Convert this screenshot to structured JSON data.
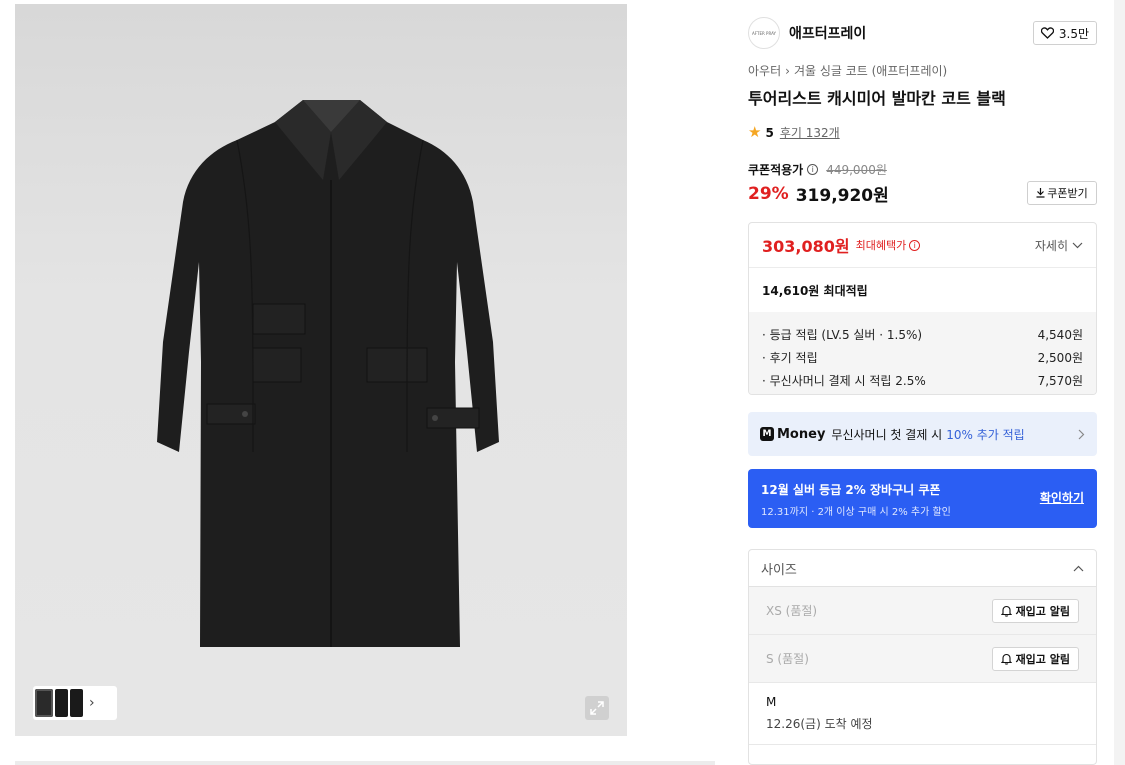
{
  "gallery": {
    "thumbnail_chevron": "›"
  },
  "brand": {
    "logo_text": "AFTER PRAY",
    "name": "애프터프레이",
    "like_count": "3.5만"
  },
  "breadcrumb": {
    "root": "아우터",
    "separator": "›",
    "category": "겨울 싱글 코트 (애프터프레이)"
  },
  "product": {
    "title": "투어리스트 캐시미어 발마칸 코트 블랙",
    "rating": "5",
    "review_label": "후기 132개"
  },
  "price": {
    "label": "쿠폰적용가",
    "original": "449,000원",
    "discount": "29%",
    "current": "319,920원",
    "coupon_button": "쿠폰받기"
  },
  "benefit": {
    "max_price": "303,080원",
    "max_label": "최대혜택가",
    "detail_button": "자세히",
    "points_total": "14,610원 최대적립",
    "points": [
      {
        "label": "· 등급 적립 (LV.5 실버 · 1.5%)",
        "value": "4,540원"
      },
      {
        "label": "· 후기 적립",
        "value": "2,500원"
      },
      {
        "label": "· 무신사머니 결제 시 적립 2.5%",
        "value": "7,570원"
      }
    ]
  },
  "money_banner": {
    "logo": "Money",
    "badge": "M",
    "text": "무신사머니 첫 결제 시",
    "highlight": "10% 추가 적립"
  },
  "coupon_banner": {
    "title": "12월 실버 등급 2% 장바구니 쿠폰",
    "subtitle": "12.31까지 · 2개 이상 구매 시 2% 추가 할인",
    "action": "확인하기"
  },
  "size_selector": {
    "label": "사이즈",
    "options": [
      {
        "label": "XS (품절)",
        "button": "재입고 알림"
      },
      {
        "label": "S (품절)",
        "button": "재입고 알림"
      },
      {
        "label": "M",
        "eta": "12.26(금) 도착 예정"
      }
    ]
  },
  "colors": {
    "discount_red": "#e02020",
    "accent_blue": "#2b5ef3",
    "money_bg": "#eaf0fb"
  }
}
